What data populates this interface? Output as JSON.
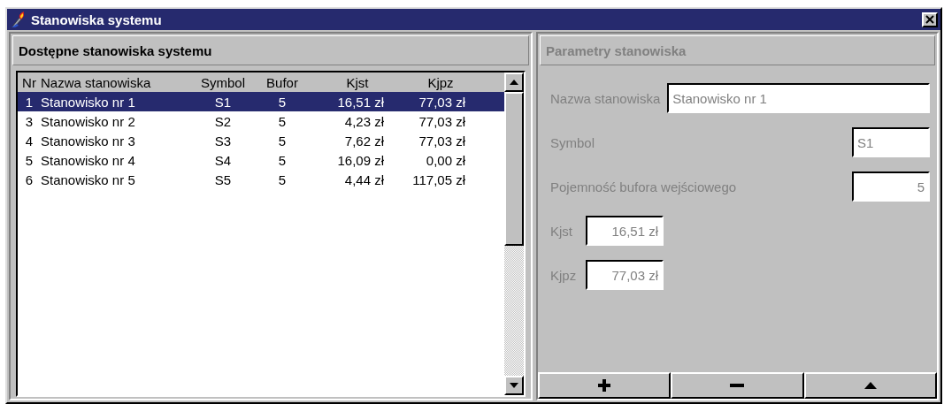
{
  "window": {
    "title": "Stanowiska systemu"
  },
  "list_panel": {
    "title": "Dostępne stanowiska systemu",
    "columns": [
      "Nr",
      "Nazwa stanowiska",
      "Symbol",
      "Bufor",
      "Kjst",
      "Kjpz"
    ],
    "rows": [
      {
        "cells": [
          "1",
          "Stanowisko nr 1",
          "S1",
          "5",
          "16,51 zł",
          "77,03 zł"
        ],
        "selected": true
      },
      {
        "cells": [
          "3",
          "Stanowisko nr 2",
          "S2",
          "5",
          "4,23 zł",
          "77,03 zł"
        ],
        "selected": false
      },
      {
        "cells": [
          "4",
          "Stanowisko nr 3",
          "S3",
          "5",
          "7,62 zł",
          "77,03 zł"
        ],
        "selected": false
      },
      {
        "cells": [
          "5",
          "Stanowisko nr 4",
          "S4",
          "5",
          "16,09 zł",
          "0,00 zł"
        ],
        "selected": false
      },
      {
        "cells": [
          "6",
          "Stanowisko nr 5",
          "S5",
          "5",
          "4,44 zł",
          "117,05 zł"
        ],
        "selected": false
      }
    ]
  },
  "detail_panel": {
    "title": "Parametry stanowiska",
    "disabled": true,
    "fields": [
      {
        "kind": "name",
        "label": "Nazwa stanowiska",
        "value": "Stanowisko nr 1"
      },
      {
        "kind": "code",
        "label": "Symbol",
        "value": "S1"
      },
      {
        "kind": "count",
        "label": "Pojemność bufora wejściowego",
        "value": "5"
      },
      {
        "kind": "amount",
        "label": "Kjst",
        "value": "16,51 zł"
      },
      {
        "kind": "amount",
        "label": "Kjpz",
        "value": "77,03 zł"
      }
    ],
    "buttons": [
      {
        "kind": "add"
      },
      {
        "kind": "remove"
      },
      {
        "kind": "up"
      }
    ]
  }
}
